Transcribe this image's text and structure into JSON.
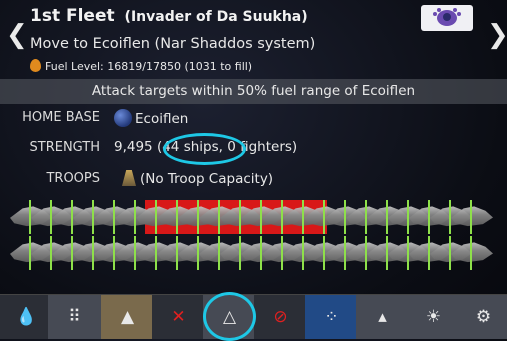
{
  "fleet": {
    "name": "1st Fleet",
    "subtitle": "(Invader of Da Suukha)",
    "order": "Move to Ecoiflen (Nar Shaddos system)",
    "fuel": "Fuel Level: 16819/17850 (1031 to fill)"
  },
  "nav": {
    "prev": "❮",
    "next": "❯"
  },
  "banner": "Attack targets within 50% fuel range of Ecoiflen",
  "info": {
    "home_base_label": "HOME BASE",
    "home_base_value": "Ecoiflen",
    "strength_label": "STRENGTH",
    "strength_value": "9,495",
    "strength_detail": "(44 ships, 0 fighters)",
    "troops_label": "TROOPS",
    "troops_value": "(No Troop Capacity)"
  },
  "ships": {
    "total": 44,
    "selected": 8
  },
  "toolbar": [
    {
      "icon": "fuel-drop-icon",
      "glyph": "💧"
    },
    {
      "icon": "formation-grid-icon",
      "glyph": "⠿"
    },
    {
      "icon": "arrow-up-icon",
      "glyph": "▲"
    },
    {
      "icon": "no-attack-icon",
      "glyph": "✕"
    },
    {
      "icon": "move-triangle-icon",
      "glyph": "△"
    },
    {
      "icon": "cancel-icon",
      "glyph": "⊘"
    },
    {
      "icon": "dots-formation-icon",
      "glyph": "⁘"
    },
    {
      "icon": "wedge-formation-icon",
      "glyph": "▴"
    },
    {
      "icon": "sun-target-icon",
      "glyph": "☀"
    },
    {
      "icon": "settings-gear-icon",
      "glyph": "⚙"
    }
  ]
}
